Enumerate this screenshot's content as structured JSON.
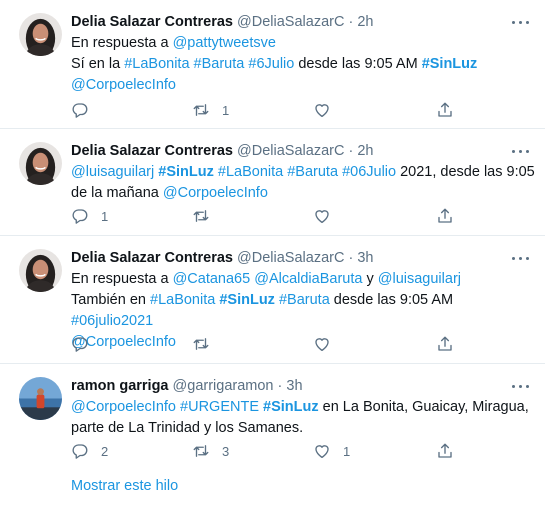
{
  "tweets": [
    {
      "name": "Delia Salazar Contreras",
      "handle": "@DeliaSalazarC",
      "sep": "·",
      "time": "2h",
      "reply_prefix": "En respuesta a ",
      "reply_to": "@pattytweetsve",
      "text": {
        "t1": "Sí en la ",
        "l1": "#LaBonita",
        "l2": "#Baruta",
        "l3": "#6Julio",
        "t2": " desde las 9:05 AM ",
        "l4": "#SinLuz",
        "l5": "@CorpoelecInfo"
      },
      "counts": {
        "reply": "",
        "retweet": "1",
        "like": ""
      }
    },
    {
      "name": "Delia Salazar Contreras",
      "handle": "@DeliaSalazarC",
      "sep": "·",
      "time": "2h",
      "text": {
        "l1": "@luisaguilarj",
        "l2": "#SinLuz",
        "l3": "#LaBonita",
        "l4": "#Baruta",
        "l5": "#06Julio",
        "t1": " 2021, desde las 9:05",
        "t2": "de la mañana ",
        "l6": "@CorpoelecInfo"
      },
      "counts": {
        "reply": "1",
        "retweet": "",
        "like": ""
      }
    },
    {
      "name": "Delia Salazar Contreras",
      "handle": "@DeliaSalazarC",
      "sep": "·",
      "time": "3h",
      "reply_prefix": "En respuesta a ",
      "reply_to_1": "@Catana65",
      "reply_to_2": "@AlcaldiaBaruta",
      "reply_and": " y ",
      "reply_to_3": "@luisaguilarj",
      "text": {
        "t1": "También en ",
        "l1": "#LaBonita",
        "l2": "#SinLuz",
        "l3": "#Baruta",
        "t2": " desde las 9:05 AM ",
        "l4": "#06julio2021",
        "l5": "@CorpoelecInfo"
      },
      "counts": {
        "reply": "",
        "retweet": "",
        "like": ""
      }
    },
    {
      "name": "ramon garriga",
      "handle": "@garrigaramon",
      "sep": "·",
      "time": "3h",
      "text": {
        "l1": "@CorpoelecInfo",
        "l2": "#URGENTE",
        "l3": "#SinLuz",
        "t1": " en La Bonita, Guaicay, Miragua,",
        "t2": "parte de La Trinidad y  los Samanes."
      },
      "counts": {
        "reply": "2",
        "retweet": "3",
        "like": "1"
      },
      "show_thread": "Mostrar este hilo"
    }
  ],
  "icons": {
    "more": "more-icon",
    "reply": "reply-icon",
    "retweet": "retweet-icon",
    "like": "like-icon",
    "share": "share-icon"
  },
  "colors": {
    "link": "#1b95e0",
    "muted": "#5b7083",
    "text": "#0f1419",
    "border": "#e6ecf0"
  }
}
